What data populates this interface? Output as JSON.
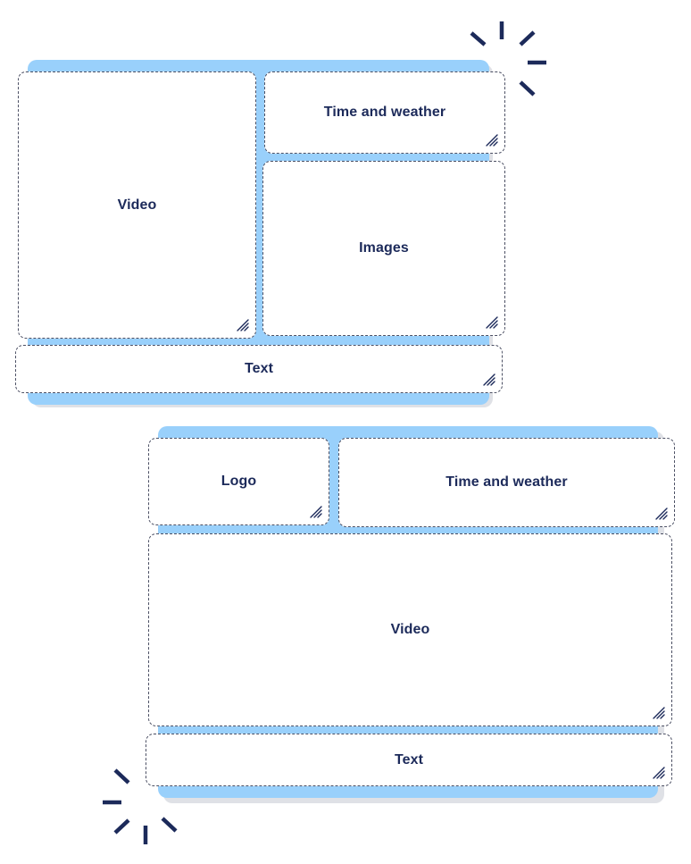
{
  "colors": {
    "accent_blue": "#99d0fb",
    "shadow_gray": "#dfe1e6",
    "label_navy": "#1c2a5a",
    "dashed_border": "#4b4f63",
    "burst_navy": "#1c2a5a"
  },
  "icons": {
    "zone_resize": "resize-handle-icon",
    "decoration": "sparkle-burst-icon"
  },
  "layout_a": {
    "zones": {
      "video": "Video",
      "time_weather": "Time and weather",
      "images": "Images",
      "text": "Text"
    }
  },
  "layout_b": {
    "zones": {
      "logo": "Logo",
      "time_weather": "Time and weather",
      "video": "Video",
      "text": "Text"
    }
  }
}
